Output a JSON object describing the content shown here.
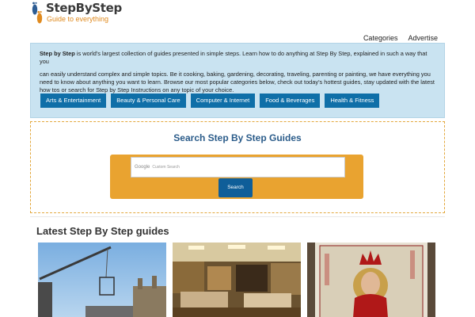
{
  "logo": {
    "title": "StepByStep",
    "tagline": "Guide to everything"
  },
  "topnav": {
    "categories": "Categories",
    "advertise": "Advertise"
  },
  "intro": {
    "brand": "Step by Step",
    "line1": " is world's largest collection of guides presented in simple steps. Learn how to do anything at Step By Step, explained in such a way that you",
    "paragraph2": "can easily understand complex and simple topics. Be it cooking, baking, gardening, decorating, traveling, parenting or painting, we have everything you need to know about anything you want to learn. Browse our most popular categories below, check out today's hottest guides, stay updated with the latest how tos or search for Step by Step Instructions on any topic of your choice."
  },
  "categories": [
    "Arts & Entertainment",
    "Beauty & Personal Care",
    "Computer & Internet",
    "Food & Beverages",
    "Health & Fitness"
  ],
  "search": {
    "title": "Search Step By Step Guides",
    "google_label": "Google",
    "placeholder": "Custom Search",
    "button": "Search"
  },
  "latest": {
    "title": "Latest Step By Step guides"
  },
  "colors": {
    "intro_bg": "#c9e3f1",
    "category_button": "#0f6fa8",
    "search_panel": "#e9a330",
    "search_title": "#2b5c8a",
    "logo_accent": "#e08a1e"
  }
}
